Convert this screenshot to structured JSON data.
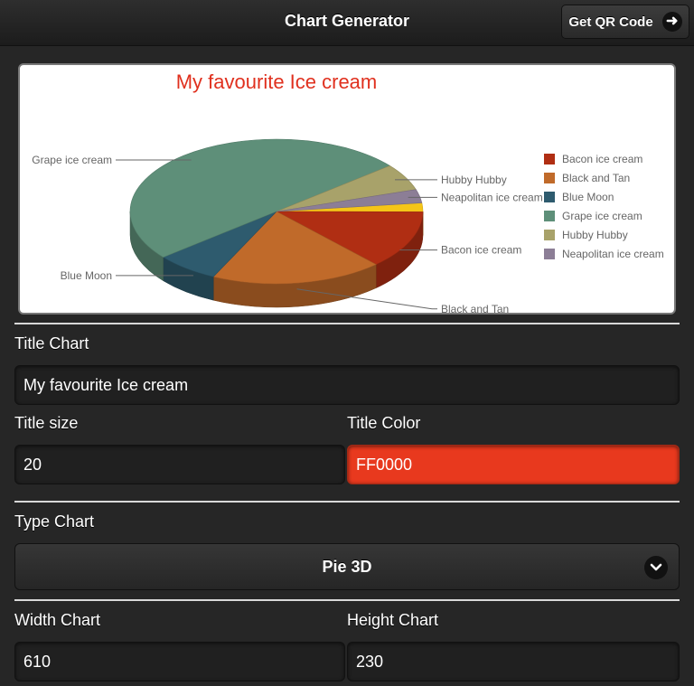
{
  "header": {
    "title": "Chart Generator",
    "qr_button_label": "Get QR Code",
    "qr_button_icon": "arrow-right-icon"
  },
  "chart_data": {
    "type": "pie",
    "variant": "3d",
    "title": "My favourite Ice cream",
    "title_color": "#e0301e",
    "legend_placement": "right",
    "slices": [
      {
        "label": "Bacon ice cream",
        "value": 13,
        "color": "#b02e13"
      },
      {
        "label": "Black and Tan",
        "value": 19,
        "color": "#c06a2a"
      },
      {
        "label": "Blue Moon",
        "value": 7,
        "color": "#2e5b6e"
      },
      {
        "label": "Grape ice cream",
        "value": 50,
        "color": "#5e8f79"
      },
      {
        "label": "Hubby Hubby",
        "value": 6,
        "color": "#a8a26a"
      },
      {
        "label": "Neapolitan ice cream",
        "value": 3,
        "color": "#8c7e96"
      },
      {
        "label": "",
        "value": 2,
        "color": "#f5c518"
      }
    ]
  },
  "form": {
    "title_chart": {
      "label": "Title Chart",
      "value": "My favourite Ice cream"
    },
    "title_size": {
      "label": "Title size",
      "value": "20"
    },
    "title_color": {
      "label": "Title Color",
      "value": "FF0000"
    },
    "type_chart": {
      "label": "Type Chart",
      "value": "Pie 3D"
    },
    "width_chart": {
      "label": "Width Chart",
      "value": "610"
    },
    "height_chart": {
      "label": "Height Chart",
      "value": "230"
    }
  }
}
